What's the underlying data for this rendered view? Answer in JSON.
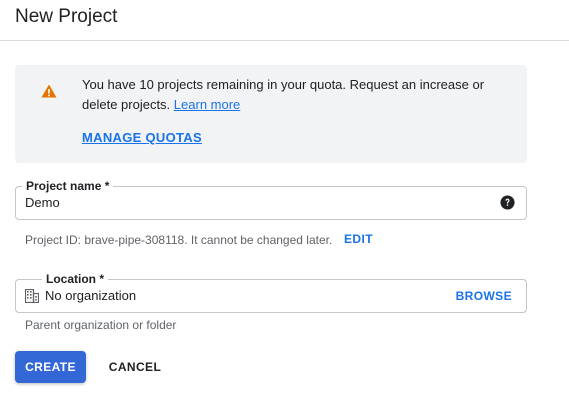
{
  "header": {
    "title": "New Project"
  },
  "quota_banner": {
    "icon": "warning-icon",
    "message": "You have 10 projects remaining in your quota. Request an increase or delete projects.",
    "learn_more": "Learn more",
    "manage_quotas": "MANAGE QUOTAS"
  },
  "project_name": {
    "label": "Project name *",
    "value": "Demo",
    "help_icon": "help-circle-icon"
  },
  "project_id": {
    "text": "Project ID: brave-pipe-308118. It cannot be changed later.",
    "edit": "EDIT"
  },
  "location": {
    "label": "Location *",
    "value": "No organization",
    "icon": "building-icon",
    "browse": "BROWSE",
    "helper": "Parent organization or folder"
  },
  "actions": {
    "create": "CREATE",
    "cancel": "CANCEL"
  },
  "colors": {
    "accent": "#1a73e8",
    "primary_button": "#3367d6",
    "warning": "#e37400",
    "banner_bg": "#f1f3f4"
  }
}
